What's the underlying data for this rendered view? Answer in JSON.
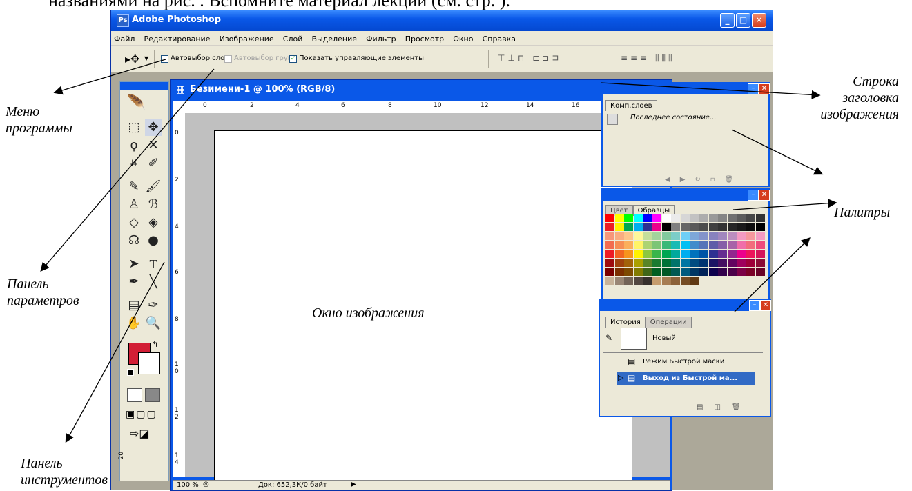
{
  "caption": "названиями на рис.    . Вспомните материал лекций (см. стр.   ).",
  "app": {
    "title": "Adobe Photoshop",
    "icon": "photoshop-icon",
    "menu": [
      "Файл",
      "Редактирование",
      "Изображение",
      "Слой",
      "Выделение",
      "Фильтр",
      "Просмотр",
      "Окно",
      "Справка"
    ],
    "options": {
      "auto_select_layer": "Автовыбор слоя",
      "auto_select_groups": "Автовыбор групп",
      "show_controls": "Показать управляющие элементы"
    }
  },
  "image_window": {
    "title": "Безимени-1 @ 100% (RGB/8)",
    "ruler_h": [
      "0",
      "2",
      "4",
      "6",
      "8",
      "10",
      "12",
      "14",
      "16"
    ],
    "ruler_v": [
      "0",
      "2",
      "4",
      "6",
      "8",
      "1\n0",
      "1\n2",
      "1\n4"
    ],
    "zoom": "100 %",
    "doc": "Док: 652,3К/0 байт",
    "side_ruler": "20"
  },
  "palettes": {
    "layer_comps": {
      "tab": "Комп.слоев",
      "item": "Последнее состояние..."
    },
    "swatches": {
      "tab_color": "Цвет",
      "tab_swatches": "Образцы"
    },
    "history": {
      "tab_history": "История",
      "tab_actions": "Операции",
      "snapshot": "Новый",
      "items": [
        "Режим Быстрой маски",
        "Выход из Быстрой ма..."
      ]
    }
  },
  "labels": {
    "menu": "Меню\nпрограммы",
    "options_panel": "Панель\nпараметров",
    "tools_panel": "Панель\nинструментов",
    "title_bar": "Строка\nзаголовка\nизображения",
    "palettes": "Палитры",
    "image_window": "Окно изображения"
  }
}
